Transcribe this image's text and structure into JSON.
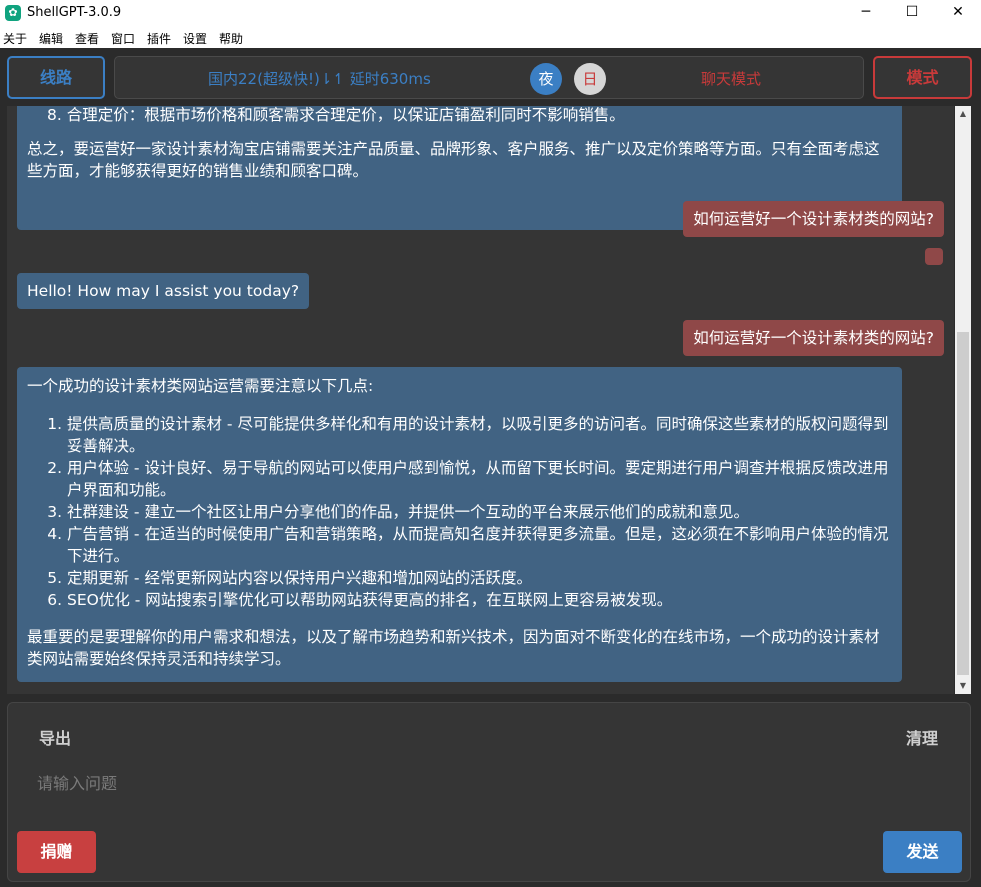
{
  "window": {
    "title": "ShellGPT-3.0.9",
    "app_icon": "openai-logo-icon",
    "controls": {
      "minimize": "─",
      "maximize": "☐",
      "close": "✕"
    }
  },
  "menu": [
    "关于",
    "编辑",
    "查看",
    "窗口",
    "插件",
    "设置",
    "帮助"
  ],
  "toolbar": {
    "route_label": "线路",
    "status": "国内22(超级快!)⇂↿ 延时630ms",
    "night_label": "夜",
    "day_label": "日",
    "chat_mode": "聊天模式",
    "mode_label": "模式"
  },
  "messages": {
    "m1": {
      "role": "assistant",
      "item8": "8. 合理定价：根据市场价格和顾客需求合理定价，以保证店铺盈利同时不影响销售。",
      "summary": "总之，要运营好一家设计素材淘宝店铺需要关注产品质量、品牌形象、客户服务、推广以及定价策略等方面。只有全面考虑这些方面，才能够获得更好的销售业绩和顾客口碑。"
    },
    "m2": {
      "role": "user",
      "text": "如何运营好一个设计素材类的网站?"
    },
    "m3": {
      "role": "user",
      "text": ""
    },
    "m4": {
      "role": "assistant",
      "text": "Hello! How may I assist you today?"
    },
    "m5": {
      "role": "user",
      "text": "如何运营好一个设计素材类的网站?"
    },
    "m6": {
      "role": "assistant",
      "intro": "一个成功的设计素材类网站运营需要注意以下几点:",
      "items": [
        "提供高质量的设计素材 - 尽可能提供多样化和有用的设计素材，以吸引更多的访问者。同时确保这些素材的版权问题得到妥善解决。",
        "用户体验 - 设计良好、易于导航的网站可以使用户感到愉悦，从而留下更长时间。要定期进行用户调查并根据反馈改进用户界面和功能。",
        "社群建设 - 建立一个社区让用户分享他们的作品，并提供一个互动的平台来展示他们的成就和意见。",
        "广告营销 - 在适当的时候使用广告和营销策略，从而提高知名度并获得更多流量。但是，这必须在不影响用户体验的情况下进行。",
        "定期更新 - 经常更新网站内容以保持用户兴趣和增加网站的活跃度。",
        "SEO优化 - 网站搜索引擎优化可以帮助网站获得更高的排名，在互联网上更容易被发现。"
      ],
      "outro": "最重要的是要理解你的用户需求和想法，以及了解市场趋势和新兴技术，因为面对不断变化的在线市场，一个成功的设计素材类网站需要始终保持灵活和持续学习。"
    }
  },
  "scrollbar": {
    "up": "▲",
    "down": "▼"
  },
  "input": {
    "export_label": "导出",
    "clear_label": "清理",
    "placeholder": "请输入问题",
    "value": "",
    "donate_label": "捐赠",
    "send_label": "发送"
  },
  "colors": {
    "accent_blue": "#3b7fc4",
    "accent_red": "#c83a3a",
    "assistant_bubble": "#416383",
    "user_bubble": "#8f4848",
    "background": "#2b2b2b"
  }
}
